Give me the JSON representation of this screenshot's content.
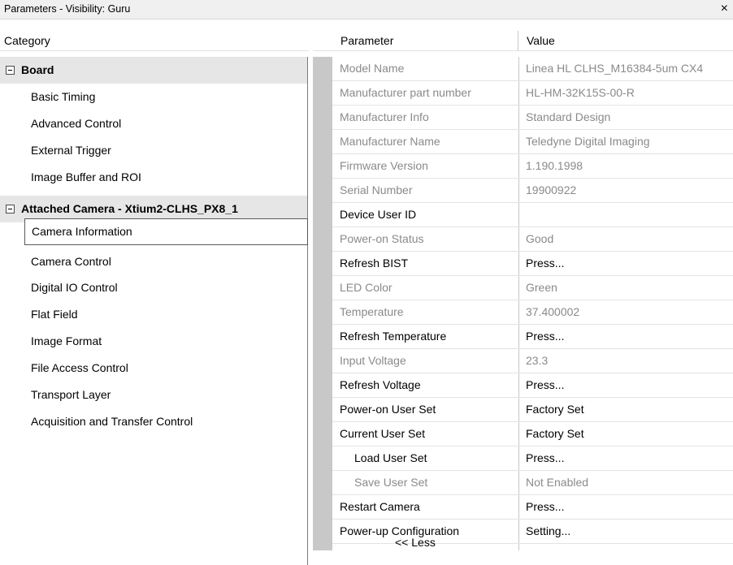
{
  "window": {
    "title": "Parameters - Visibility: Guru",
    "close_glyph": "×",
    "close_icon": "close-icon"
  },
  "headers": {
    "category": "Category",
    "parameter": "Parameter",
    "value": "Value"
  },
  "categories": {
    "board": {
      "label": "Board",
      "items": [
        "Basic Timing",
        "Advanced Control",
        "External Trigger",
        "Image Buffer and ROI"
      ]
    },
    "camera": {
      "label": "Attached Camera - Xtium2-CLHS_PX8_1",
      "items": [
        "Camera Information",
        "Camera Control",
        "Digital IO Control",
        "Flat Field",
        "Image Format",
        "File Access Control",
        "Transport Layer",
        "Acquisition and Transfer Control"
      ],
      "selected": "Camera Information"
    }
  },
  "parameters": [
    {
      "name": "Model Name",
      "value": "Linea HL CLHS_M16384-5um CX4",
      "editable": false
    },
    {
      "name": "Manufacturer part number",
      "value": "HL-HM-32K15S-00-R",
      "editable": false
    },
    {
      "name": "Manufacturer Info",
      "value": "Standard Design",
      "editable": false
    },
    {
      "name": "Manufacturer Name",
      "value": "Teledyne Digital Imaging",
      "editable": false
    },
    {
      "name": "Firmware Version",
      "value": "1.190.1998",
      "editable": false
    },
    {
      "name": "Serial Number",
      "value": "19900922",
      "editable": false
    },
    {
      "name": "Device User ID",
      "value": "",
      "editable": true
    },
    {
      "name": "Power-on Status",
      "value": "Good",
      "editable": false
    },
    {
      "name": "Refresh BIST",
      "value": "Press...",
      "editable": true
    },
    {
      "name": "LED Color",
      "value": "Green",
      "editable": false
    },
    {
      "name": "Temperature",
      "value": "37.400002",
      "editable": false
    },
    {
      "name": "Refresh Temperature",
      "value": "Press...",
      "editable": true
    },
    {
      "name": "Input Voltage",
      "value": "23.3",
      "editable": false
    },
    {
      "name": "Refresh Voltage",
      "value": "Press...",
      "editable": true
    },
    {
      "name": "Power-on User Set",
      "value": "Factory Set",
      "editable": true
    },
    {
      "name": "Current User Set",
      "value": "Factory Set",
      "editable": true
    },
    {
      "name": "Load User Set",
      "value": "Press...",
      "editable": true
    },
    {
      "name": "Save User Set",
      "value": "Not Enabled",
      "editable": false
    },
    {
      "name": "Restart Camera",
      "value": "Press...",
      "editable": true
    },
    {
      "name": "Power-up Configuration",
      "value": "Setting...",
      "editable": true
    }
  ],
  "less_label": "<< Less",
  "colors": {
    "readonly_text": "#8a8a8a",
    "group_bg": "#e6e6e6",
    "gutter": "#c8c8c8"
  }
}
